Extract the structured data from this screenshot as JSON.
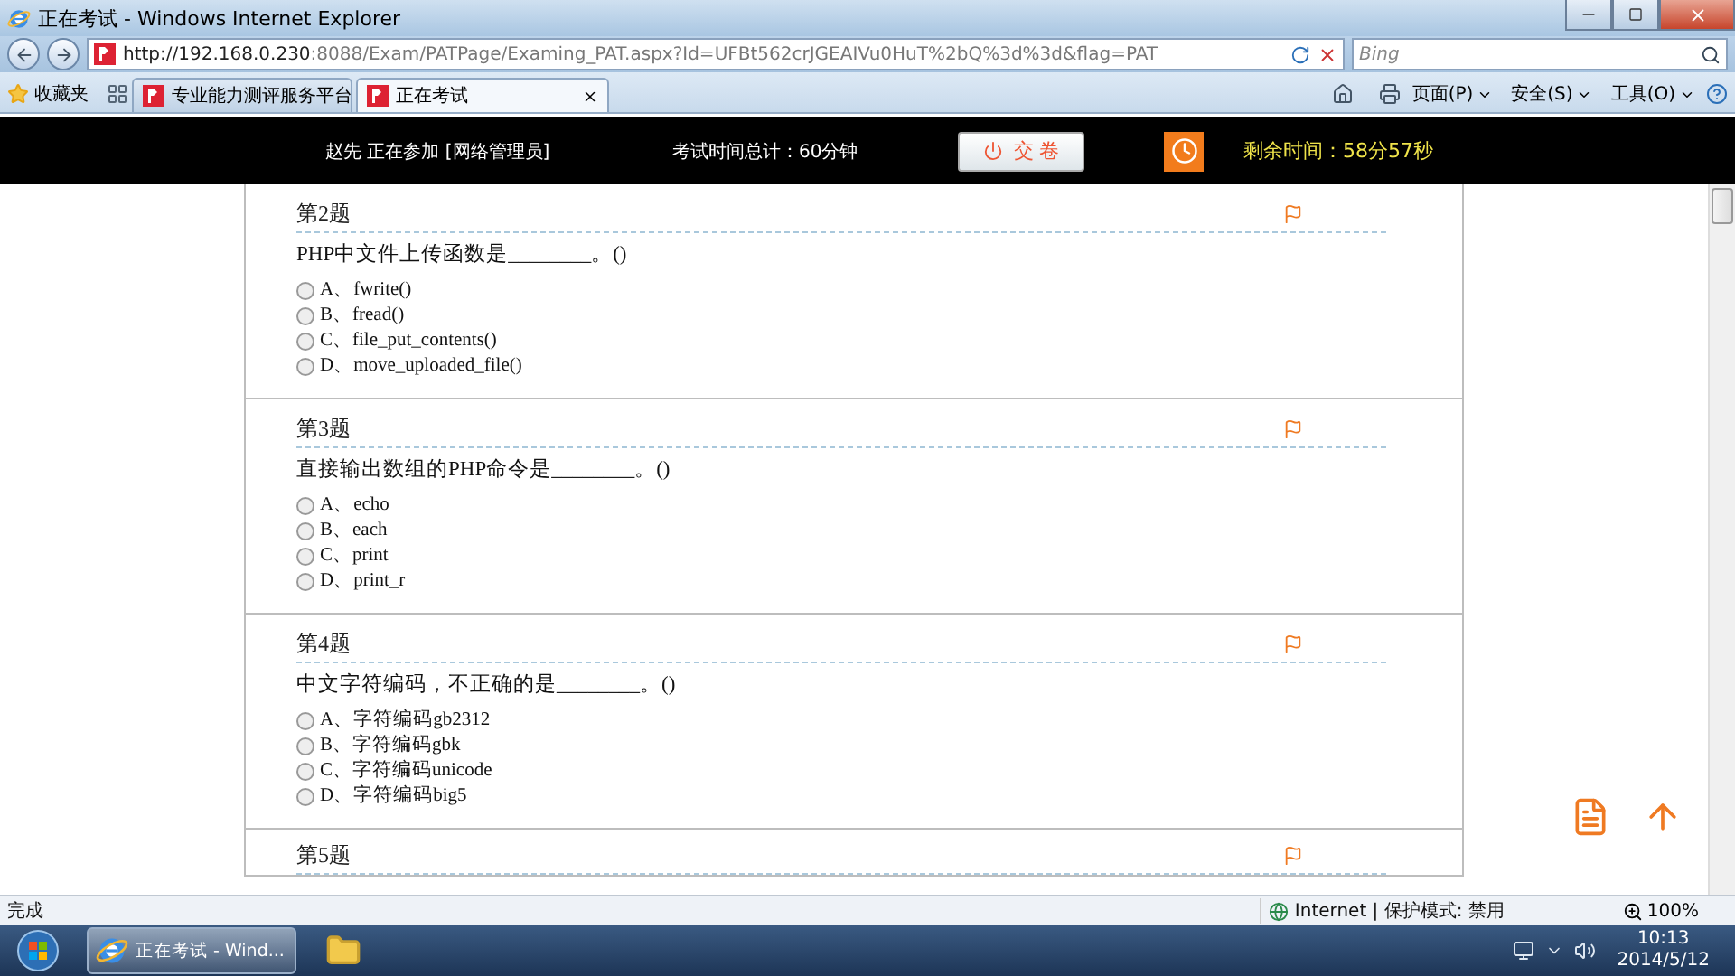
{
  "window": {
    "title": "正在考试 - Windows Internet Explorer"
  },
  "address_bar": {
    "url_host": "http://192.168.0.230",
    "url_rest": ":8088/Exam/PATPage/Examing_PAT.aspx?Id=UFBt562crJGEAIVu0HuT%2bQ%3d%3d&flag=PAT"
  },
  "search": {
    "placeholder": "Bing"
  },
  "favorites": {
    "label": "收藏夹"
  },
  "tabs": [
    {
      "label": "专业能力测评服务平台",
      "selected": false
    },
    {
      "label": "正在考试",
      "selected": true
    }
  ],
  "command_bar": [
    "页面(P)",
    "安全(S)",
    "工具(O)"
  ],
  "exam_header": {
    "candidate": "赵先  正在参加  [网络管理员]",
    "total_time": "考试时间总计：60分钟",
    "submit": "交 卷",
    "remaining": "剩余时间：58分57秒"
  },
  "questions": [
    {
      "number": "第2题",
      "text": "PHP中文件上传函数是________。()",
      "options": [
        {
          "label": "A、fwrite()",
          "selected": false
        },
        {
          "label": "B、fread()",
          "selected": false
        },
        {
          "label": "C、file_put_contents()",
          "selected": false
        },
        {
          "label": "D、move_uploaded_file()",
          "selected": false
        }
      ]
    },
    {
      "number": "第3题",
      "text": "直接输出数组的PHP命令是________。()",
      "options": [
        {
          "label": "A、echo",
          "selected": false
        },
        {
          "label": "B、each",
          "selected": false
        },
        {
          "label": "C、print",
          "selected": false
        },
        {
          "label": "D、print_r",
          "selected": false
        }
      ]
    },
    {
      "number": "第4题",
      "text": "中文字符编码，不正确的是________。()",
      "options": [
        {
          "label": "A、字符编码gb2312",
          "selected": false
        },
        {
          "label": "B、字符编码gbk",
          "selected": false
        },
        {
          "label": "C、字符编码unicode",
          "selected": false
        },
        {
          "label": "D、字符编码big5",
          "selected": false
        }
      ]
    },
    {
      "number": "第5题"
    }
  ],
  "status_bar": {
    "status": "完成",
    "zone": "Internet | 保护模式: 禁用",
    "zoom": "100%"
  },
  "taskbar": {
    "task": "正在考试 - Wind...",
    "time": "10:13",
    "date": "2014/5/12"
  }
}
